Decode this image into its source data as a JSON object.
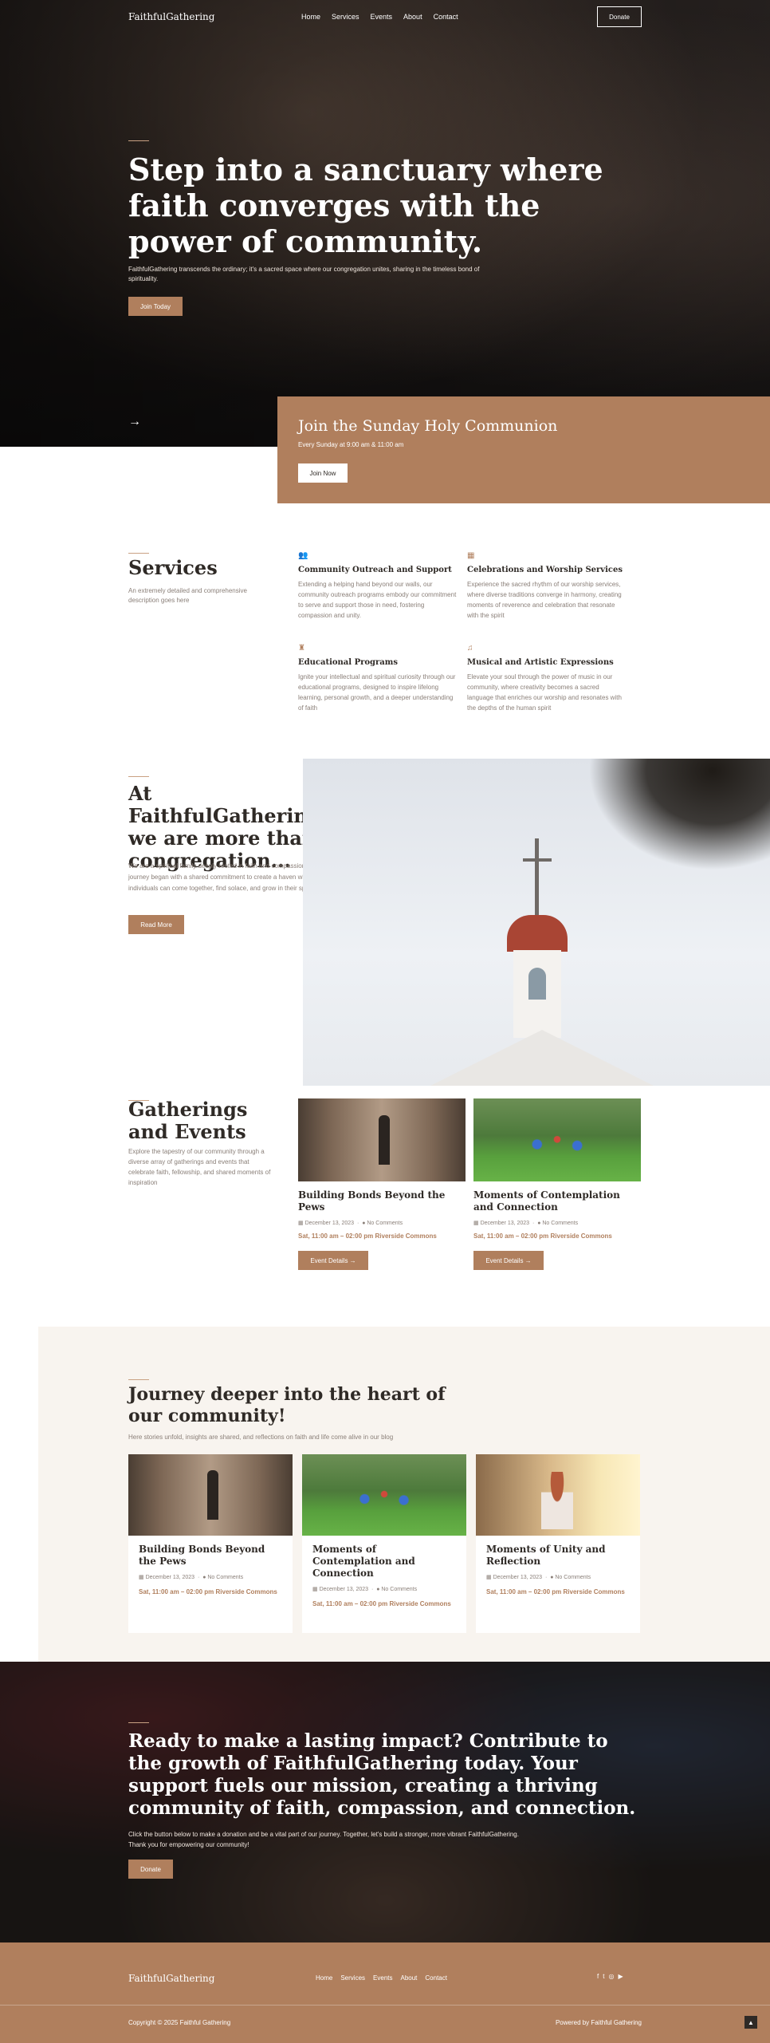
{
  "colors": {
    "accent": "#b07f5d",
    "cream": "#f8f4ef",
    "dark": "#2f2a26"
  },
  "nav": {
    "brand": "FaithfulGathering",
    "items": [
      "Home",
      "Services",
      "Events",
      "About",
      "Contact"
    ],
    "donate": "Donate"
  },
  "hero": {
    "title": "Step into a sanctuary where faith converges with the power of community.",
    "subtitle": "FaithfulGathering transcends the ordinary; it's a sacred space where our congregation unites, sharing in the timeless bond of spirituality.",
    "cta": "Join Today",
    "arrow_icon": "arrow-right-icon"
  },
  "communion": {
    "title": "Join the Sunday Holy Communion",
    "time": "Every Sunday at 9:00 am & 11:00 am",
    "cta": "Join Now"
  },
  "services": {
    "title": "Services",
    "description": "An extremely detailed and comprehensive description goes here",
    "items": [
      {
        "icon": "people-icon",
        "title": "Community Outreach and Support",
        "text": "Extending a helping hand beyond our walls, our community outreach programs embody our commitment to serve and support those in need, fostering compassion and unity."
      },
      {
        "icon": "cake-icon",
        "title": "Celebrations and Worship Services",
        "text": "Experience the sacred rhythm of our worship services, where diverse traditions converge in harmony, creating moments of reverence and celebration that resonate with the spirit"
      },
      {
        "icon": "trophy-icon",
        "title": "Educational Programs",
        "text": "Ignite your intellectual and spiritual curiosity through our educational programs, designed to inspire lifelong learning, personal growth, and a deeper understanding of faith"
      },
      {
        "icon": "music-icon",
        "title": "Musical and Artistic Expressions",
        "text": "Elevate your soul through the power of music in our community, where creativity becomes a sacred language that enriches our worship and resonates with the depths of the human spirit"
      }
    ]
  },
  "about": {
    "title": "At FaithfulGathering, we are more than a congregation...",
    "text": "We are a spiritual family deeply rooted in faith and compassion. Our journey began with a shared commitment to create a haven where individuals can come together, find solace, and grow in their spirituality...",
    "cta": "Read More"
  },
  "gatherings": {
    "title": "Gatherings and Events",
    "description": "Explore the tapestry of our community through a diverse array of gatherings and events that celebrate faith, fellowship, and shared moments of inspiration",
    "events": [
      {
        "title": "Building Bonds Beyond the Pews",
        "date": "December 13, 2023",
        "comments": "No Comments",
        "when": "Sat, 11:00 am – 02:00 pm Riverside Commons",
        "cta": "Event Details →"
      },
      {
        "title": "Moments of Contemplation and Connection",
        "date": "December 13, 2023",
        "comments": "No Comments",
        "when": "Sat, 11:00 am – 02:00 pm Riverside Commons",
        "cta": "Event Details →"
      }
    ]
  },
  "blog": {
    "title": "Journey deeper into the heart of our community!",
    "subtitle": "Here stories unfold, insights are shared, and reflections on faith and life come alive in our blog",
    "posts": [
      {
        "title": "Building Bonds Beyond the Pews",
        "date": "December 13, 2023",
        "comments": "No Comments",
        "when": "Sat, 11:00 am – 02:00 pm Riverside Commons"
      },
      {
        "title": "Moments of Contemplation and Connection",
        "date": "December 13, 2023",
        "comments": "No Comments",
        "when": "Sat, 11:00 am – 02:00 pm Riverside Commons"
      },
      {
        "title": "Moments of Unity and Reflection",
        "date": "December 13, 2023",
        "comments": "No Comments",
        "when": "Sat, 11:00 am – 02:00 pm Riverside Commons"
      }
    ]
  },
  "cta": {
    "title": "Ready to make a lasting impact? Contribute to the growth of FaithfulGathering today. Your support fuels our mission, creating a thriving community of faith, compassion, and connection.",
    "text": "Click the button below to make a donation and be a vital part of our journey. Together, let's build a stronger, more vibrant FaithfulGathering. Thank you for empowering our community!",
    "button": "Donate"
  },
  "footer": {
    "brand": "FaithfulGathering",
    "items": [
      "Home",
      "Services",
      "Events",
      "About",
      "Contact"
    ],
    "copyright": "Copyright © 2025 Faithful Gathering",
    "powered": "Powered by Faithful Gathering",
    "social_icons": [
      "facebook-icon",
      "twitter-icon",
      "instagram-icon",
      "youtube-icon"
    ]
  }
}
